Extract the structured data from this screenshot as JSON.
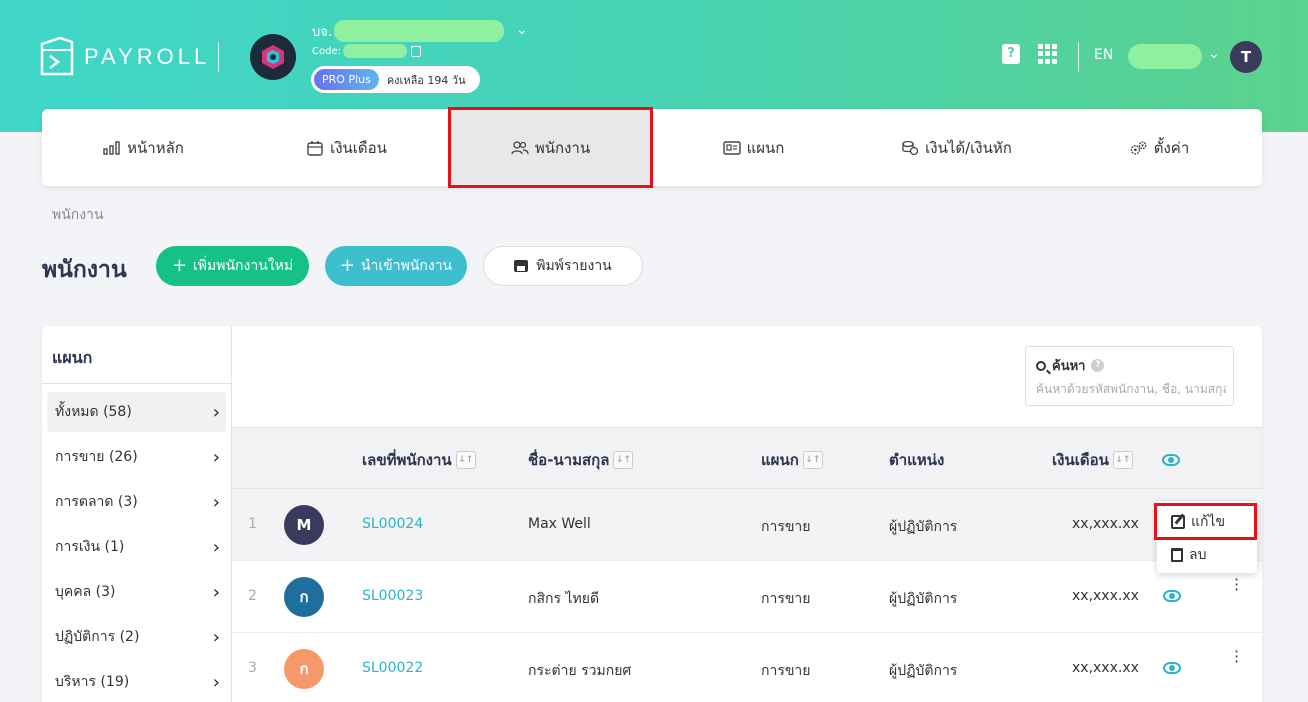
{
  "header": {
    "logo_text": "PAYROLL",
    "company_prefix": "บจ.",
    "code_label": "Code:",
    "plan_name": "PRO Plus",
    "plan_remaining": "คงเหลือ 194 วัน",
    "help_label": "?",
    "language": "EN",
    "user_initial": "T"
  },
  "nav": {
    "items": [
      {
        "label": "หน้าหลัก",
        "icon": "chart-icon"
      },
      {
        "label": "เงินเดือน",
        "icon": "calendar-icon"
      },
      {
        "label": "พนักงาน",
        "icon": "users-icon"
      },
      {
        "label": "แผนก",
        "icon": "id-card-icon"
      },
      {
        "label": "เงินได้/เงินหัก",
        "icon": "money-icon"
      },
      {
        "label": "ตั้งค่า",
        "icon": "gears-icon"
      }
    ],
    "active_index": 2
  },
  "breadcrumb": "พนักงาน",
  "page_title": "พนักงาน",
  "actions": {
    "add_label": "เพิ่มพนักงานใหม่",
    "import_label": "นำเข้าพนักงาน",
    "print_label": "พิมพ์รายงาน"
  },
  "departments": {
    "title": "แผนก",
    "items": [
      {
        "label": "ทั้งหมด (58)"
      },
      {
        "label": "การขาย (26)"
      },
      {
        "label": "การตลาด (3)"
      },
      {
        "label": "การเงิน (1)"
      },
      {
        "label": "บุคคล (3)"
      },
      {
        "label": "ปฏิบัติการ (2)"
      },
      {
        "label": "บริหาร (19)"
      }
    ]
  },
  "search": {
    "label": "ค้นหา",
    "placeholder": "ค้นหาด้วยรหัสพนักงาน, ชื่อ, นามสกุล"
  },
  "table": {
    "columns": {
      "id": "เลขที่พนักงาน",
      "name": "ชื่อ-นามสกุล",
      "dept": "แผนก",
      "position": "ตำแหน่ง",
      "salary": "เงินเดือน"
    },
    "sort_glyph": "↓↑",
    "rows": [
      {
        "num": "1",
        "initial": "M",
        "avatar_color": "#3a3a5c",
        "id": "SL00024",
        "name": "Max Well",
        "dept": "การขาย",
        "position": "ผู้ปฏิบัติการ",
        "salary": "xx,xxx.xx"
      },
      {
        "num": "2",
        "initial": "ก",
        "avatar_color": "#1f6f9e",
        "id": "SL00023",
        "name": "กสิกร ไทยดี",
        "dept": "การขาย",
        "position": "ผู้ปฏิบัติการ",
        "salary": "xx,xxx.xx"
      },
      {
        "num": "3",
        "initial": "ก",
        "avatar_color": "#f5986a",
        "id": "SL00022",
        "name": "กระต่าย รวมกยศ",
        "dept": "การขาย",
        "position": "ผู้ปฏิบัติการ",
        "salary": "xx,xxx.xx"
      }
    ]
  },
  "context_menu": {
    "edit_label": "แก้ไข",
    "delete_label": "ลบ"
  }
}
